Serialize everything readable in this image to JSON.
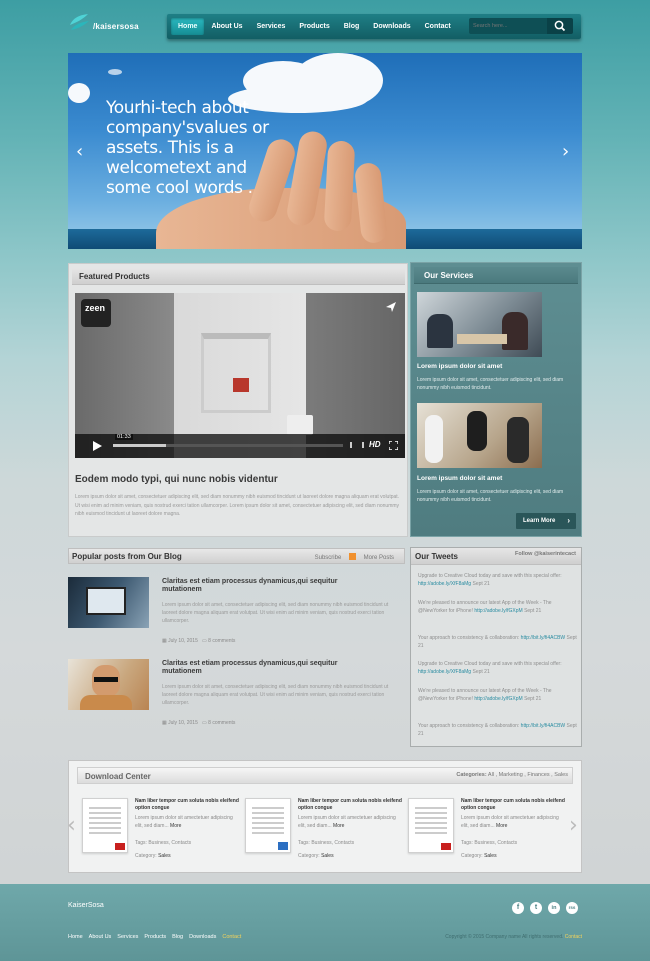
{
  "header": {
    "logo_text": "/kaisersosa",
    "nav": [
      "Home",
      "About Us",
      "Services",
      "Products",
      "Blog",
      "Downloads",
      "Contact"
    ],
    "active_nav": "Home",
    "search_placeholder": "Search here..."
  },
  "hero": {
    "text": "Yourhi-tech about company'svalues or assets. This is a welcometext and some cool words .",
    "prev": "‹",
    "next": "›"
  },
  "featured": {
    "title": "Featured Products",
    "video_time": "01:33",
    "video_badge": "zeen",
    "video_hd": "HD",
    "video_progress": 0.23,
    "heading": "Eodem modo typi, qui nunc nobis videntur",
    "text": "Lorem ipsum dolor sit amet, consectetuer adipiscing elit, sed diam nonummy nibh euismod tincidunt ut laoreet dolore magna aliquam erat volutpat. Ut wisi enim ad minim veniam, quis nostrud exerci tation ullamcorper. Lorem ipsum dolor sit amet, consectetuer adipiscing elit, sed diam nonummy nibh euismod tincidunt ut laoreet dolore magna."
  },
  "services": {
    "title": "Our Services",
    "items": [
      {
        "heading": "Lorem ipsum dolor sit amet",
        "text": "Lorem ipsum dolor sit amet, consectetuer adipiscing elit, sed diam nonummy nibh euismod tincidunt."
      },
      {
        "heading": "Lorem ipsum dolor sit amet",
        "text": "Lorem ipsum dolor sit amet, consectetuer adipiscing elit, sed diam nonummy nibh euismod tincidunt."
      }
    ],
    "learn_more": "Learn More"
  },
  "blog": {
    "title": "Popular posts from Our Blog",
    "subscribe": "Subscribe",
    "more": "More Posts",
    "posts": [
      {
        "title": "Claritas est etiam processus dynamicus,qui sequitur mutationem",
        "text": "Lorem ipsum dolor sit amet, consectetuer adipiscing elit, sed diam nonummy nibh euismod tincidunt ut laoreet dolore magna aliquam erat volutpat. Ut wisi enim ad minim veniam, quis nostrud exerci tation ullamcorper.",
        "date": "July 10, 2015",
        "comments": "8 comments"
      },
      {
        "title": "Claritas est etiam processus dynamicus,qui sequitur mutationem",
        "text": "Lorem ipsum dolor sit amet, consectetuer adipiscing elit, sed diam nonummy nibh euismod tincidunt ut laoreet dolore magna aliquam erat volutpat. Ut wisi enim ad minim veniam, quis nostrud exerci tation ullamcorper.",
        "date": "July 10, 2015",
        "comments": "8 comments"
      }
    ]
  },
  "tweets": {
    "title": "Our Tweets",
    "follow": "Follow @kaiserintecact",
    "items": [
      {
        "text": "Upgrade to Creative Cloud today and save with this special offer:",
        "link": "http://adobe.ly/XfF8aMg",
        "date": "Sept 21"
      },
      {
        "text": "We're pleased to announce our latest App of the Week - The @NewYorker for iPhone!",
        "link": "http://adobe.ly/fGXpM",
        "date": "Sept 21"
      },
      {
        "text": "Your approach to consistency & collaboration:",
        "link": "http://bit.ly/fi4ACBW",
        "date": "Sept 21"
      },
      {
        "text": "Upgrade to Creative Cloud today and save with this special offer:",
        "link": "http://adobe.ly/XfF8aMg",
        "date": "Sept 21"
      },
      {
        "text": "We're pleased to announce our latest App of the Week - The @NewYorker for iPhone!",
        "link": "http://adobe.ly/fGXpM",
        "date": "Sept 21"
      },
      {
        "text": "Your approach to consistency & collaboration:",
        "link": "http://bit.ly/fi4ACBW",
        "date": "Sept 21"
      }
    ]
  },
  "download": {
    "title": "Download Center",
    "categories_label": "Categories:",
    "categories": "All , Marketing , Finances , Sales",
    "docs": [
      {
        "title": "Nam liber tempor cum soluta nobis eleifend option congue",
        "text": "Lorem ipsum dolor sit amectetuer adipiscing elit, sed diam...",
        "more": "More",
        "tags": "Tags: Business, Contacts",
        "category_label": "Category:",
        "category": "Sales"
      },
      {
        "title": "Nam liber tempor cum soluta nobis eleifend option congue",
        "text": "Lorem ipsum dolor sit amectetuer adipiscing elit, sed diam...",
        "more": "More",
        "tags": "Tags: Business, Contacts",
        "category_label": "Category:",
        "category": "Sales"
      },
      {
        "title": "Nam liber tempor cum soluta nobis eleifend option congue",
        "text": "Lorem ipsum dolor sit amectetuer adipiscing elit, sed diam...",
        "more": "More",
        "tags": "Tags: Business, Contacts",
        "category_label": "Category:",
        "category": "Sales"
      }
    ]
  },
  "footer": {
    "brand": "KaiserSosa",
    "social": [
      "f",
      "t",
      "in",
      "rss"
    ],
    "nav": [
      "Home",
      "About Us",
      "Services",
      "Products",
      "Blog",
      "Downloads",
      "Contact"
    ],
    "copyright": "Copyright © 2015 Company name All rights reserved.",
    "copyright_link": "Contact"
  },
  "colors": {
    "accent": "#168d94",
    "nav_dark": "#125e64",
    "services_bg": "#5e8e92",
    "footer_bg": "#6fa8aa"
  }
}
